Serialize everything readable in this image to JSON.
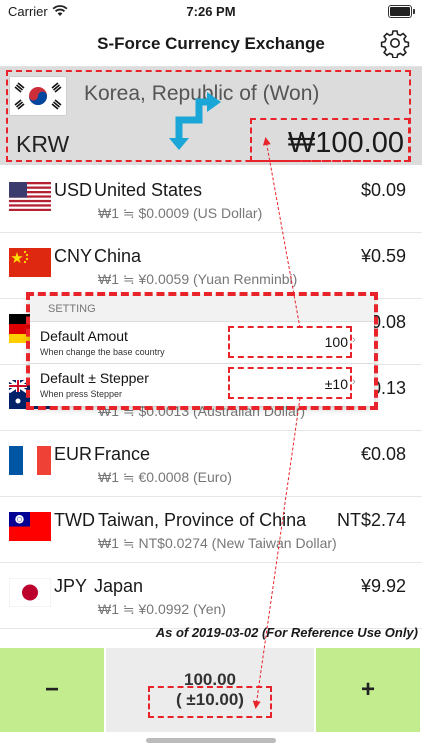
{
  "status_bar": {
    "carrier": "Carrier",
    "time": "7:26 PM"
  },
  "nav": {
    "title": "S-Force Currency Exchange",
    "settings_icon": "gear-icon"
  },
  "base": {
    "country": "Korea, Republic of (Won)",
    "code": "KRW",
    "amount": "₩100.00",
    "flag": "south-korea-flag"
  },
  "rows": [
    {
      "code": "USD",
      "name": "United States",
      "value": "$0.09",
      "rate": "₩1 ≒ $0.0009 (US Dollar)",
      "flag": "us-flag"
    },
    {
      "code": "CNY",
      "name": "China",
      "value": "¥0.59",
      "rate": "₩1 ≒ ¥0.0059 (Yuan Renminbi)",
      "flag": "china-flag"
    },
    {
      "code": "",
      "name": "",
      "value": "0.08",
      "rate": "",
      "flag": "germany-flag"
    },
    {
      "code": "",
      "name": "",
      "value": "0.13",
      "rate": "₩1 ≒ $0.0013 (Australian Dollar)",
      "flag": "australia-flag"
    },
    {
      "code": "EUR",
      "name": "France",
      "value": "€0.08",
      "rate": "₩1 ≒ €0.0008 (Euro)",
      "flag": "france-flag"
    },
    {
      "code": "TWD",
      "name": "Taiwan, Province of China",
      "value": "NT$2.74",
      "rate": "₩1 ≒ NT$0.0274 (New Taiwan Dollar)",
      "flag": "taiwan-flag"
    },
    {
      "code": "JPY",
      "name": "Japan",
      "value": "¥9.92",
      "rate": "₩1 ≒ ¥0.0992 (Yen)",
      "flag": "japan-flag"
    }
  ],
  "as_of": "As of 2019-03-02 (For Reference Use Only)",
  "settings_popup": {
    "header": "SETTING",
    "default_amount": {
      "label": "Default Amout",
      "sub": "When change the base country",
      "value": "100"
    },
    "default_stepper": {
      "label": "Default ± Stepper",
      "sub": "When press Stepper",
      "value": "±10"
    }
  },
  "bottom": {
    "minus_label": "−",
    "plus_label": "+",
    "amount": "100.00",
    "stepper": "( ±10.00)"
  },
  "colors": {
    "stepper_green": "#c3ec8e",
    "annotation_red": "#e8242a",
    "swap_blue": "#1aa6d6",
    "base_bg": "#dcdcdc"
  }
}
